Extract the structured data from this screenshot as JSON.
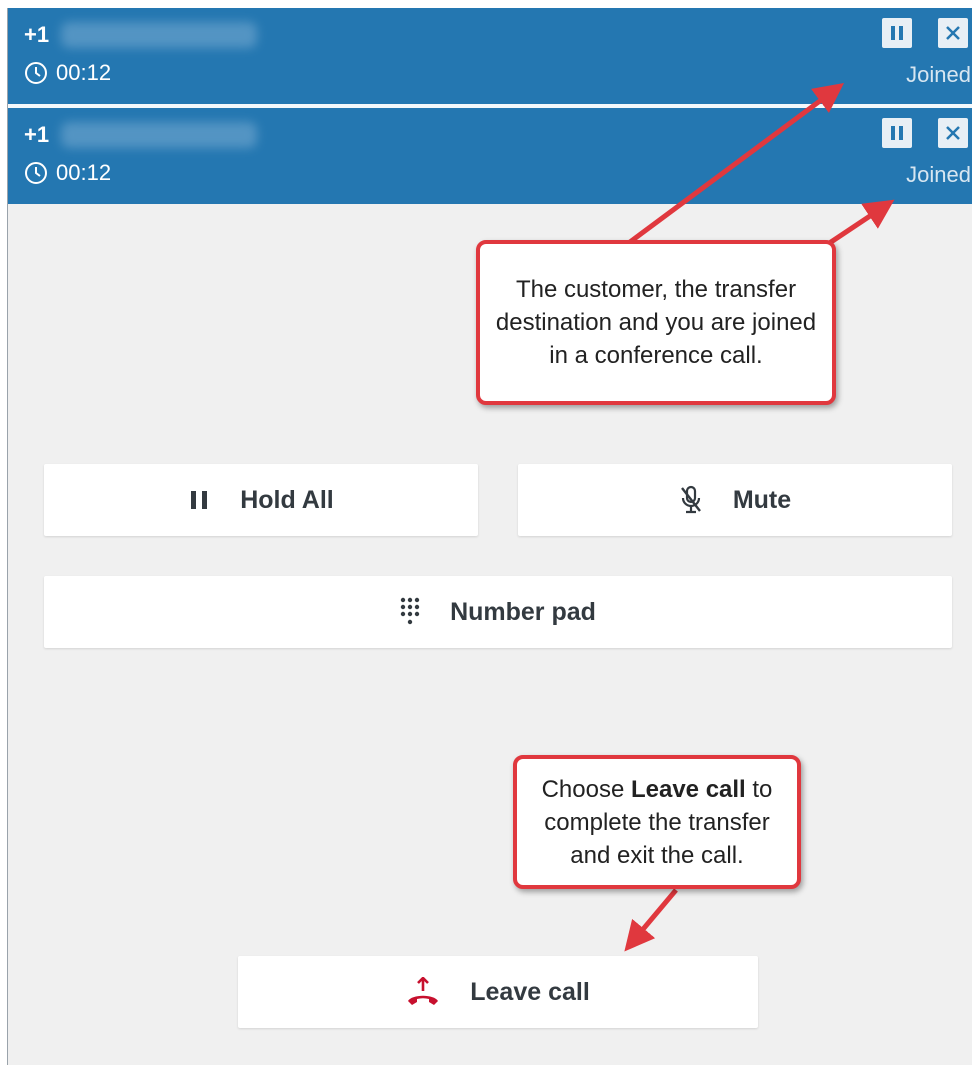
{
  "calls": [
    {
      "number": "+1",
      "timer": "00:12",
      "status": "Joined"
    },
    {
      "number": "+1",
      "timer": "00:12",
      "status": "Joined"
    }
  ],
  "actions": {
    "hold_all": "Hold All",
    "mute": "Mute",
    "number_pad": "Number pad",
    "leave_call": "Leave call"
  },
  "callouts": {
    "conference": "The customer, the transfer destination and you are joined in a conference call.",
    "leave_prefix": "Choose ",
    "leave_bold": "Leave call",
    "leave_suffix": " to complete the transfer and exit the call."
  },
  "colors": {
    "header_blue": "#2477b1",
    "callout_red": "#e0383e",
    "leave_icon_red": "#c7102e"
  },
  "icons": [
    "clock-icon",
    "pause-icon",
    "close-icon",
    "mute-mic-icon",
    "dialpad-icon",
    "leave-call-icon"
  ]
}
